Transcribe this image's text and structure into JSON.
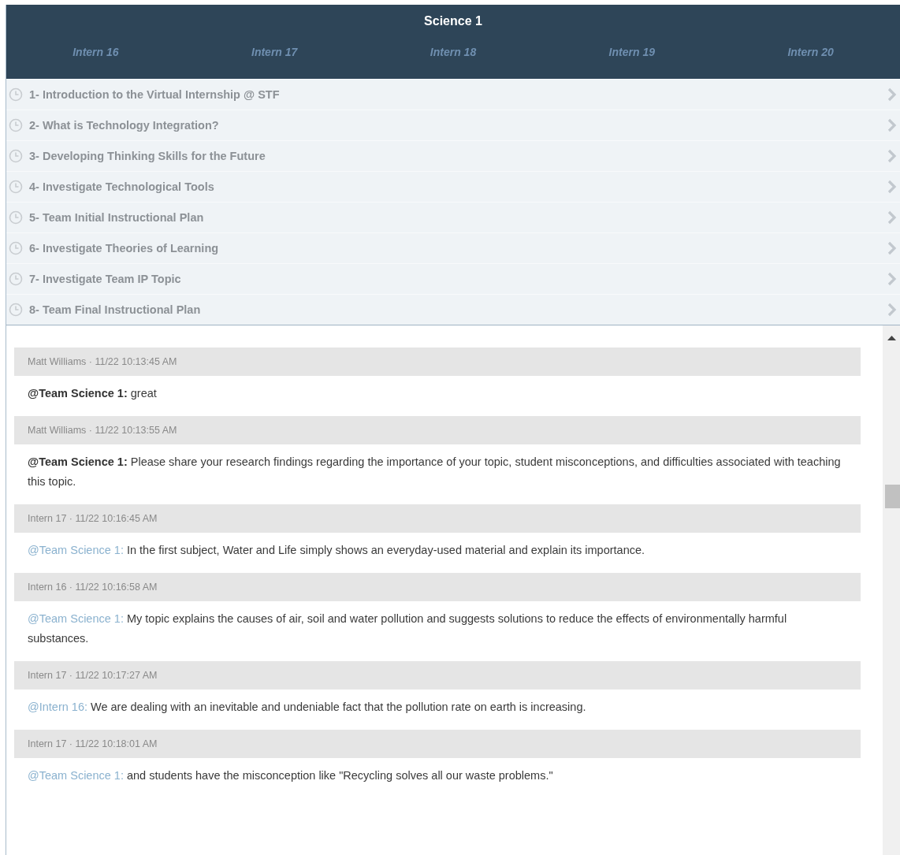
{
  "header": {
    "title": "Science 1",
    "interns": [
      "Intern 16",
      "Intern 17",
      "Intern 18",
      "Intern 19",
      "Intern 20"
    ]
  },
  "lessons": [
    "1- Introduction to the Virtual Internship @ STF",
    "2- What is Technology Integration?",
    "3- Developing Thinking Skills for the Future",
    "4- Investigate Technological Tools",
    "5- Team Initial Instructional Plan",
    "6- Investigate Theories of Learning",
    "7- Investigate Team IP Topic",
    "8- Team Final Instructional Plan"
  ],
  "messages": [
    {
      "header": "Matt Williams · 11/22 10:13:45 AM",
      "mention": "@Team Science 1:",
      "kind": "bold",
      "text": "great"
    },
    {
      "header": "Matt Williams · 11/22 10:13:55 AM",
      "mention": "@Team Science 1:",
      "kind": "bold",
      "text": "Please share your research findings regarding the importance of your topic, student misconceptions, and difficulties associated with teaching this topic."
    },
    {
      "header": "Intern 17 · 11/22 10:16:45 AM",
      "mention": "@Team Science 1:",
      "kind": "link",
      "text": "In the first subject, Water and Life simply shows an everyday-used material and explain its importance."
    },
    {
      "header": "Intern 16 · 11/22 10:16:58 AM",
      "mention": "@Team Science 1:",
      "kind": "link",
      "text": "My topic explains the causes of air, soil and water pollution and suggests solutions to reduce the effects of environmentally harmful substances."
    },
    {
      "header": "Intern 17 · 11/22 10:17:27 AM",
      "mention": "@Intern 16:",
      "kind": "link",
      "text": "We are dealing with an inevitable and undeniable fact that the pollution rate on earth is increasing."
    },
    {
      "header": "Intern 17 · 11/22 10:18:01 AM",
      "mention": "@Team Science 1:",
      "kind": "link",
      "text": "and students have the misconception like \"Recycling solves all our waste problems.\""
    }
  ]
}
